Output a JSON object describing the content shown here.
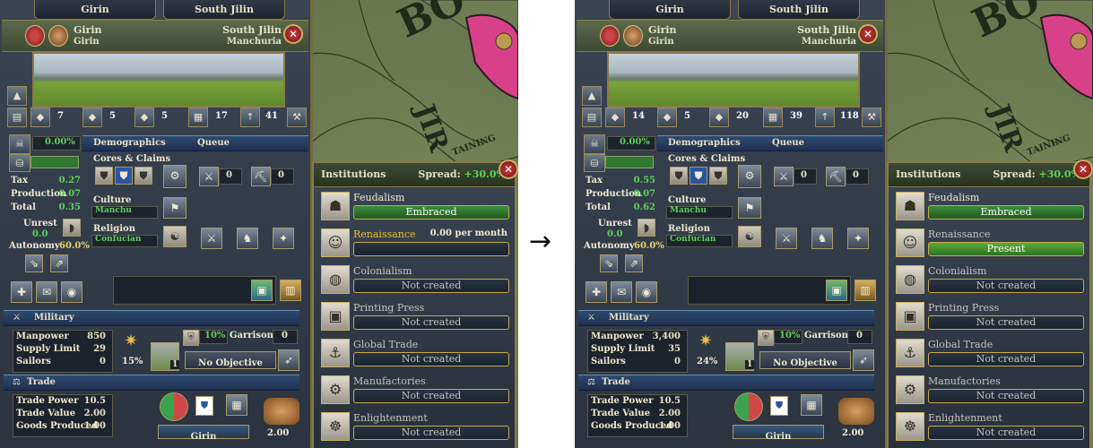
{
  "arrow": "→",
  "frames": [
    {
      "tabs": [
        "Girin",
        "South Jilin"
      ],
      "header": {
        "left_name": "Girin",
        "left_sub": "Girin",
        "right_name": "South Jilin",
        "right_sub": "Manchuria"
      },
      "top_counts": [
        "7",
        "5",
        "5",
        "17",
        "41"
      ],
      "demographics": {
        "autonomy_pct_top": "0.00%",
        "section": "Demographics",
        "queue": "Queue",
        "tax_label": "Tax",
        "tax": "0.27",
        "production_label": "Production",
        "production": "0.07",
        "total_label": "Total",
        "total": "0.35",
        "unrest_label": "Unrest",
        "unrest": "0.0",
        "autonomy_label": "Autonomy",
        "autonomy": "60.0%",
        "cores_label": "Cores & Claims",
        "culture_label": "Culture",
        "culture": "Manchu",
        "religion_label": "Religion",
        "religion": "Confucian",
        "queue_val1": "0",
        "queue_val2": "0"
      },
      "military": {
        "section": "Military",
        "manpower_label": "Manpower",
        "manpower": "850",
        "supply_label": "Supply Limit",
        "supply": "29",
        "sailors_label": "Sailors",
        "sailors": "0",
        "fort_pct": "15%",
        "fort_level": "1",
        "garrison_pct": "10%",
        "garrison_label": "Garrison:",
        "garrison": "0",
        "objective": "No Objective"
      },
      "trade": {
        "section": "Trade",
        "power_label": "Trade Power",
        "power": "10.5",
        "value_label": "Trade Value",
        "value": "2.00",
        "goods_label": "Goods Produced",
        "goods": "1.00",
        "node": "Girin",
        "goods_value": "2.00"
      },
      "institutions": {
        "title": "Institutions",
        "spread_label": "Spread:",
        "spread": "+30.0%",
        "items": [
          {
            "name": "Feudalism",
            "status": "Embraced",
            "state": "embraced"
          },
          {
            "name": "Renaissance",
            "status": "",
            "rate": "0.00 per month",
            "state": "progress"
          },
          {
            "name": "Colonialism",
            "status": "Not created",
            "state": "none"
          },
          {
            "name": "Printing Press",
            "status": "Not created",
            "state": "none"
          },
          {
            "name": "Global Trade",
            "status": "Not created",
            "state": "none"
          },
          {
            "name": "Manufactories",
            "status": "Not created",
            "state": "none"
          },
          {
            "name": "Enlightenment",
            "status": "Not created",
            "state": "none"
          }
        ]
      }
    },
    {
      "tabs": [
        "Girin",
        "South Jilin"
      ],
      "header": {
        "left_name": "Girin",
        "left_sub": "Girin",
        "right_name": "South Jilin",
        "right_sub": "Manchuria"
      },
      "top_counts": [
        "14",
        "5",
        "20",
        "39",
        "118"
      ],
      "demographics": {
        "autonomy_pct_top": "0.00%",
        "section": "Demographics",
        "queue": "Queue",
        "tax_label": "Tax",
        "tax": "0.55",
        "production_label": "Production",
        "production": "0.07",
        "total_label": "Total",
        "total": "0.62",
        "unrest_label": "Unrest",
        "unrest": "0.0",
        "autonomy_label": "Autonomy",
        "autonomy": "60.0%",
        "cores_label": "Cores & Claims",
        "culture_label": "Culture",
        "culture": "Manchu",
        "religion_label": "Religion",
        "religion": "Confucian",
        "queue_val1": "0",
        "queue_val2": "0"
      },
      "military": {
        "section": "Military",
        "manpower_label": "Manpower",
        "manpower": "3,400",
        "supply_label": "Supply Limit",
        "supply": "35",
        "sailors_label": "Sailors",
        "sailors": "0",
        "fort_pct": "24%",
        "fort_level": "1",
        "garrison_pct": "10%",
        "garrison_label": "Garrison:",
        "garrison": "0",
        "objective": "No Objective"
      },
      "trade": {
        "section": "Trade",
        "power_label": "Trade Power",
        "power": "10.5",
        "value_label": "Trade Value",
        "value": "2.00",
        "goods_label": "Goods Produced",
        "goods": "1.00",
        "node": "Girin",
        "goods_value": "2.00"
      },
      "institutions": {
        "title": "Institutions",
        "spread_label": "Spread:",
        "spread": "+30.0%",
        "items": [
          {
            "name": "Feudalism",
            "status": "Embraced",
            "state": "embraced"
          },
          {
            "name": "Renaissance",
            "status": "Present",
            "state": "present"
          },
          {
            "name": "Colonialism",
            "status": "Not created",
            "state": "none"
          },
          {
            "name": "Printing Press",
            "status": "Not created",
            "state": "none"
          },
          {
            "name": "Global Trade",
            "status": "Not created",
            "state": "none"
          },
          {
            "name": "Manufactories",
            "status": "Not created",
            "state": "none"
          },
          {
            "name": "Enlightenment",
            "status": "Not created",
            "state": "none"
          }
        ]
      }
    }
  ],
  "map_labels": [
    "BO",
    "JIR",
    "TAINING"
  ]
}
